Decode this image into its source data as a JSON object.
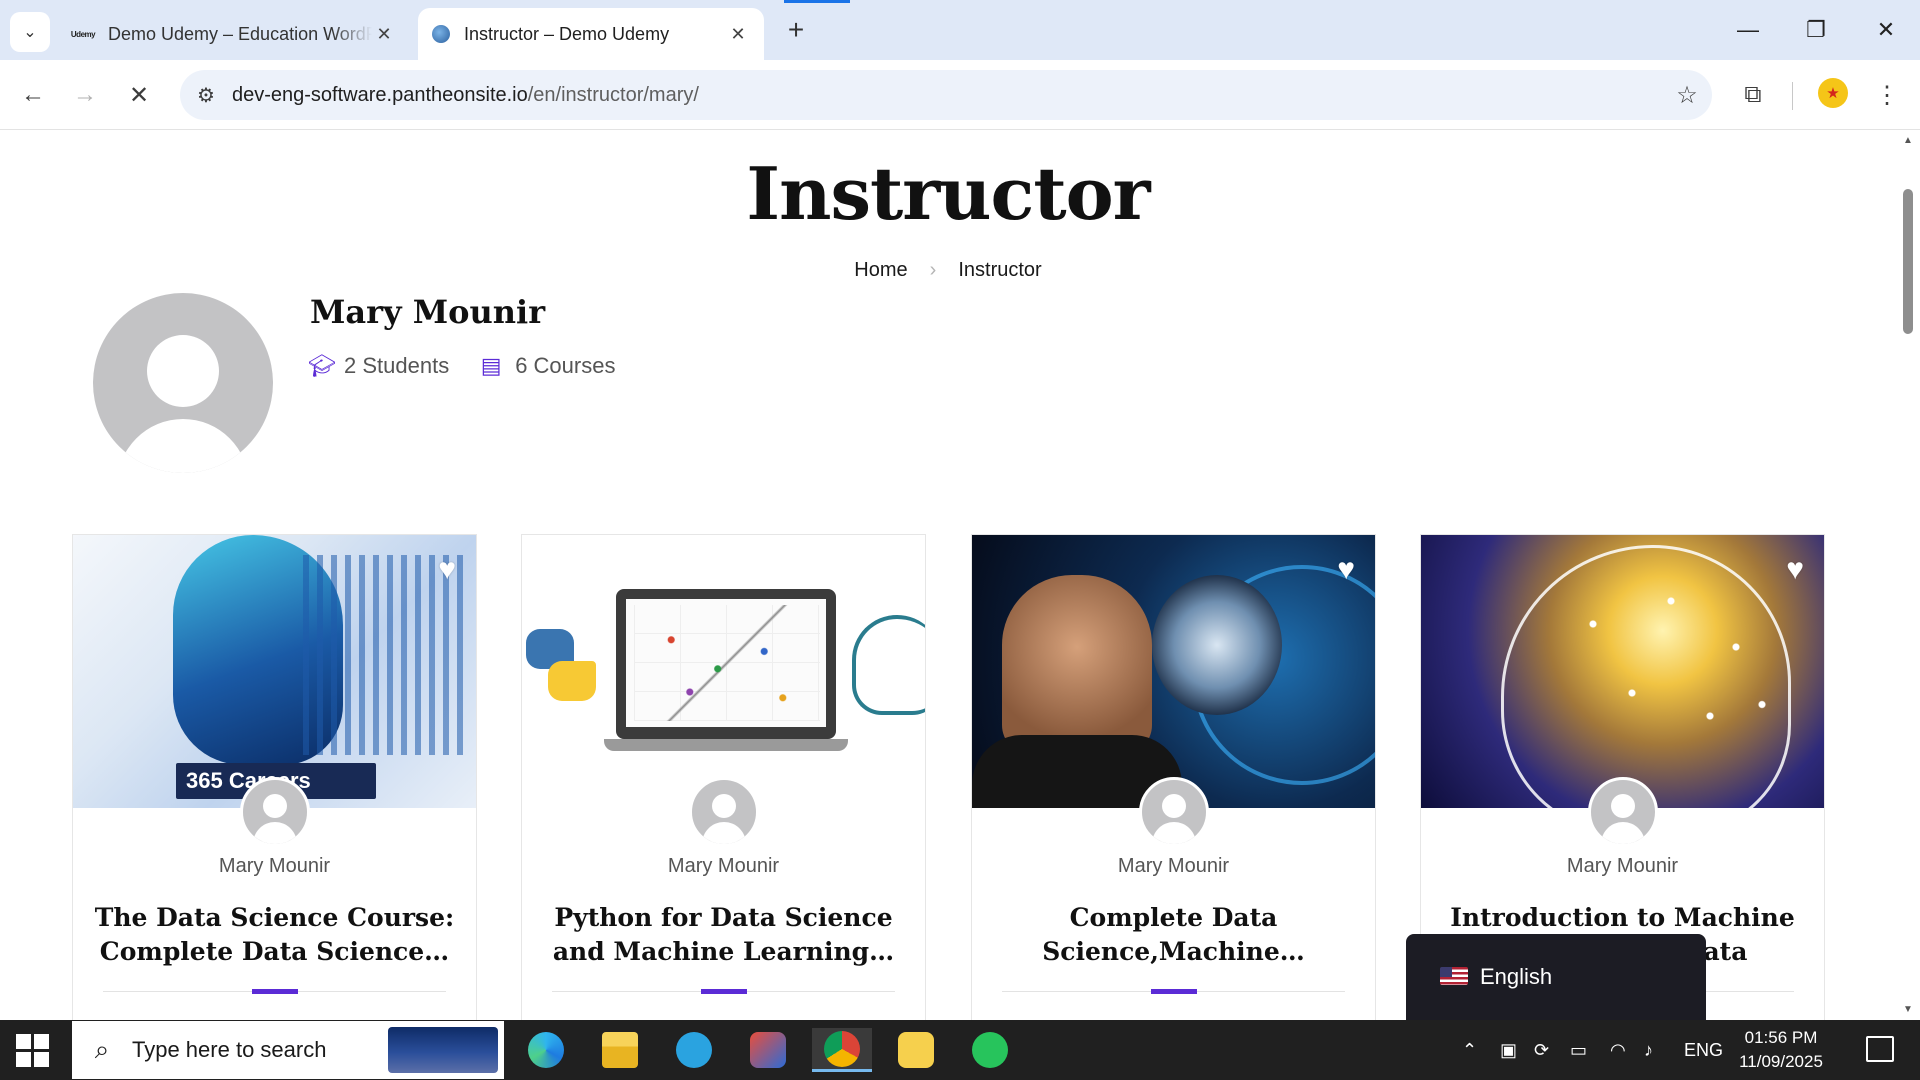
{
  "browser": {
    "tabs": [
      {
        "favicon": "Udemy",
        "title": "Demo Udemy – Education WordPress Theme",
        "close": "✕"
      },
      {
        "favicon": "globe-icon",
        "title": "Instructor – Demo Udemy",
        "close": "✕"
      }
    ],
    "new_tab": "+",
    "window_controls": {
      "minimize": "—",
      "maximize": "❐",
      "close": "✕"
    },
    "url_host": "dev-eng-software.pantheonsite.io",
    "url_path": "/en/instructor/mary/"
  },
  "page": {
    "title": "Instructor",
    "breadcrumb": {
      "home": "Home",
      "separator": "›",
      "current": "Instructor"
    },
    "instructor": {
      "name": "Mary Mounir",
      "students": "2 Students",
      "courses": "6 Courses"
    },
    "accent_color": "#5b2bd6",
    "cards": [
      {
        "author": "Mary Mounir",
        "title": "The Data Science Course: Complete Data Science…",
        "badge": "365 Careers"
      },
      {
        "author": "Mary Mounir",
        "title": "Python for Data Science and Machine Learning…"
      },
      {
        "author": "Mary Mounir",
        "title": "Complete Data Science,Machine…"
      },
      {
        "author": "Mary Mounir",
        "title": "Introduction to Machine Learning for Data Science"
      }
    ],
    "language_switcher": "English"
  },
  "taskbar": {
    "search_placeholder": "Type here to search",
    "tray_lang": "ENG",
    "time": "01:56 PM",
    "date": "11/09/2025"
  }
}
